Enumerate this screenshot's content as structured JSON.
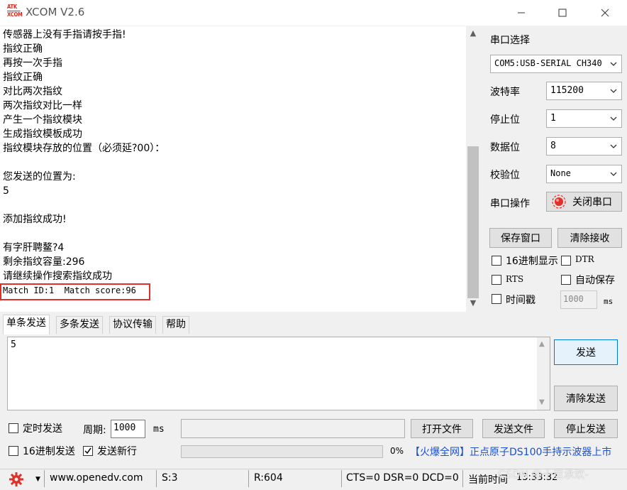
{
  "window": {
    "title": "XCOM V2.6",
    "logo_line1": "ATK",
    "logo_line2": "XCOM"
  },
  "receive": {
    "lines": [
      "传感器上没有手指请按手指!",
      "指纹正确",
      "再按一次手指",
      "指纹正确",
      "对比两次指纹",
      "两次指纹对比一样",
      "产生一个指纹模块",
      "生成指纹模板成功",
      "指纹模块存放的位置（必须延?00）：",
      "",
      "您发送的位置为:",
      "5",
      "",
      "添加指纹成功!",
      "",
      "有字肝聘鳌?4",
      "剩余指纹容量:296",
      "请继续操作搜索指纹成功",
      "Match ID:1  Match score:96"
    ]
  },
  "serial": {
    "section_label": "串口选择",
    "port_value": "COM5:USB-SERIAL CH340",
    "baud_label": "波特率",
    "baud_value": "115200",
    "stop_label": "停止位",
    "stop_value": "1",
    "data_label": "数据位",
    "data_value": "8",
    "parity_label": "校验位",
    "parity_value": "None",
    "op_label": "串口操作",
    "op_button": "关闭串口",
    "save_window": "保存窗口",
    "clear_receive": "清除接收",
    "hex_display": "16进制显示",
    "dtr": "DTR",
    "rts": "RTS",
    "auto_save": "自动保存",
    "timestamp": "时间戳",
    "timestamp_value": "1000",
    "ms": "ms"
  },
  "tabs": [
    "单条发送",
    "多条发送",
    "协议传输",
    "帮助"
  ],
  "send": {
    "text": "5",
    "send_button": "发送",
    "clear_button": "清除发送",
    "timed_send": "定时发送",
    "period_label": "周期:",
    "period_value": "1000",
    "period_unit": "ms",
    "open_file": "打开文件",
    "send_file": "发送文件",
    "stop_send": "停止发送",
    "hex_send": "16进制发送",
    "send_newline": "发送新行",
    "progress_text": "0%",
    "progress": 0,
    "promo": "【火爆全网】正点原子DS100手持示波器上市"
  },
  "status": {
    "url": "www.openedv.com",
    "sent": "S:3",
    "received": "R:604",
    "lines": "CTS=0 DSR=0 DCD=0",
    "time_label": "当前时间",
    "time_value": "13:33:32",
    "watermark": "CSDN @十里承欢-"
  },
  "colors": {
    "accent_red": "#e0302a",
    "promo_blue": "#1a4fd6"
  }
}
